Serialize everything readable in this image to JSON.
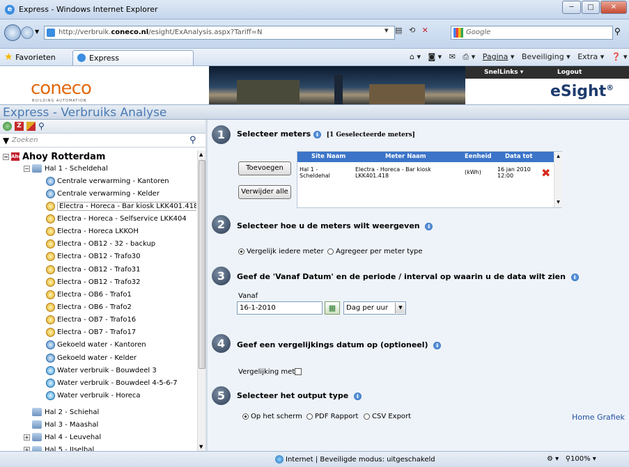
{
  "browser": {
    "window_title": "Express - Windows Internet Explorer",
    "url_prefix": "http://verbruik.",
    "url_domain": "coneco.nl",
    "url_suffix": "/esight/ExAnalysis.aspx?Tariff=N",
    "search_placeholder": "Google",
    "favorites_label": "Favorieten",
    "tab_label": "Express",
    "cmd_pagina": "Pagina",
    "cmd_beveiliging": "Beveiliging",
    "cmd_extra": "Extra",
    "status_zone": "Internet | Beveiligde modus: uitgeschakeld",
    "zoom": "100%"
  },
  "site": {
    "logo": "coneco",
    "logo_sub": "BUILDING AUTOMATION",
    "snellinks": "SnelLinks",
    "logout": "Logout",
    "brand": "eSight",
    "brand_mark": "®",
    "page_title": "Express - Verbruiks Analyse"
  },
  "tree": {
    "search_placeholder": "Zoeken",
    "root": "Ahoy Rotterdam",
    "root_icon_text": "Ahoy",
    "hal1": "Hal 1 - Scheldehal",
    "meters": [
      "Centrale verwarming - Kantoren",
      "Centrale verwarming - Kelder",
      "Electra - Horeca - Bar kiosk LKK401.418",
      "Electra - Horeca - Selfservice LKK404",
      "Electra - Horeca LKKOH",
      "Electra - OB12 - 32 - backup",
      "Electra - OB12 - Trafo30",
      "Electra - OB12 - Trafo31",
      "Electra - OB12 - Trafo32",
      "Electra - OB6 - Trafo1",
      "Electra - OB6 - Trafo2",
      "Electra - OB7 - Trafo16",
      "Electra - OB7 - Trafo17",
      "Gekoeld water - Kantoren",
      "Gekoeld water - Kelder",
      "Water verbruik - Bouwdeel 3",
      "Water verbruik - Bouwdeel 4-5-6-7",
      "Water verbruik - Horeca"
    ],
    "halls": [
      "Hal 2 - Schiehal",
      "Hal 3 - Maashal",
      "Hal 4 - Leuvehal",
      "Hal 5 - IJselhal"
    ]
  },
  "steps": {
    "s1": {
      "num": "1",
      "title": "Selecteer meters",
      "count": "[1 Geselecteerde meters]",
      "add_btn": "Toevoegen",
      "remove_all_btn": "Verwijder alle",
      "columns": [
        "Site Naam",
        "Meter Naam",
        "Eenheid",
        "Data tot"
      ],
      "row": {
        "site": "Hal 1 - Scheldehal",
        "meter": "Electra - Horeca - Bar kiosk LKK401.418",
        "unit": "(kWh)",
        "date": "16 jan 2010 12:00"
      }
    },
    "s2": {
      "num": "2",
      "title": "Selecteer hoe u de meters wilt weergeven",
      "opt1": "Vergelijk iedere meter",
      "opt2": "Agregeer per meter type"
    },
    "s3": {
      "num": "3",
      "title": "Geef de 'Vanaf Datum' en de periode / interval op waarin u de data wilt zien",
      "vanaf_label": "Vanaf",
      "date_value": "16-1-2010",
      "interval": "Dag per uur"
    },
    "s4": {
      "num": "4",
      "title": "Geef een vergelijkings datum op (optioneel)",
      "compare_label": "Vergelijking met"
    },
    "s5": {
      "num": "5",
      "title": "Selecteer het output type",
      "opt1": "Op het scherm",
      "opt2": "PDF Rapport",
      "opt3": "CSV Export",
      "home_link": "Home Grafiek"
    }
  },
  "colors": {
    "accent": "#3b74c9",
    "logo": "#e36a10",
    "title": "#4a7ab5"
  }
}
